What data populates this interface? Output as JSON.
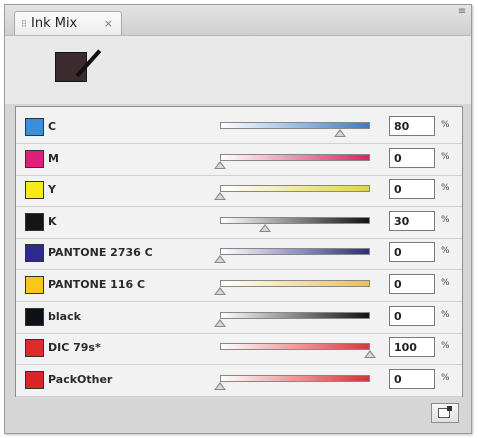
{
  "panel": {
    "tab_label": "Ink Mix",
    "tab_close": "×",
    "menu_glyph": "≡",
    "preview_color": "#3b2a2e"
  },
  "inks": [
    {
      "name": "C",
      "value": "80",
      "level": 80,
      "chip": "#3b8fd6",
      "gradient": [
        "#ffffff",
        "#3b7cc8"
      ],
      "unit": "%"
    },
    {
      "name": "M",
      "value": "0",
      "level": 0,
      "chip": "#e01e7d",
      "gradient": [
        "#ffffff",
        "#d9255f"
      ],
      "unit": "%"
    },
    {
      "name": "Y",
      "value": "0",
      "level": 0,
      "chip": "#f6ea17",
      "gradient": [
        "#ffffff",
        "#e2d24a"
      ],
      "unit": "%"
    },
    {
      "name": "K",
      "value": "30",
      "level": 30,
      "chip": "#151515",
      "gradient": [
        "#ffffff",
        "#111111"
      ],
      "unit": "%"
    },
    {
      "name": "PANTONE 2736 C",
      "value": "0",
      "level": 0,
      "chip": "#2d2a8e",
      "gradient": [
        "#ffffff",
        "#2f2b86"
      ],
      "unit": "%"
    },
    {
      "name": "PANTONE 116 C",
      "value": "0",
      "level": 0,
      "chip": "#f7c81a",
      "gradient": [
        "#ffffff",
        "#e7c54a"
      ],
      "unit": "%"
    },
    {
      "name": "black",
      "value": "0",
      "level": 0,
      "chip": "#0e1116",
      "gradient": [
        "#ffffff",
        "#111111"
      ],
      "unit": "%"
    },
    {
      "name": "DIC 79s*",
      "value": "100",
      "level": 100,
      "chip": "#dd2a2a",
      "gradient": [
        "#ffffff",
        "#d63a3a"
      ],
      "unit": "%"
    },
    {
      "name": "PackOther",
      "value": "0",
      "level": 0,
      "chip": "#d92525",
      "gradient": [
        "#ffffff",
        "#d23434"
      ],
      "unit": "%"
    }
  ]
}
